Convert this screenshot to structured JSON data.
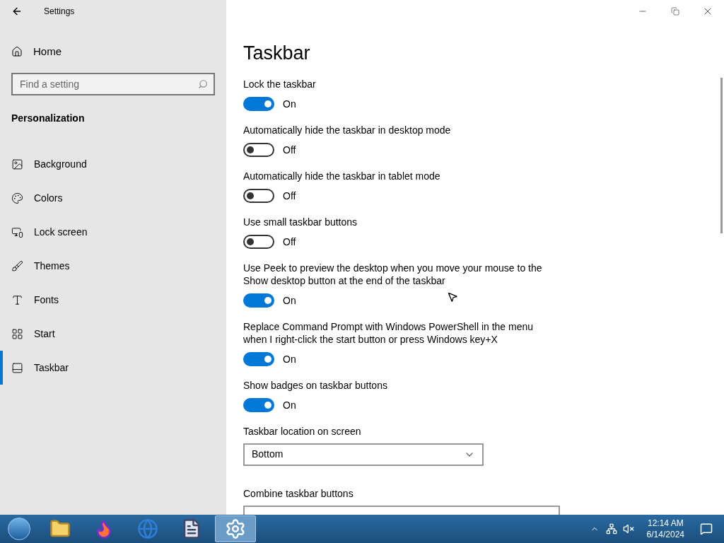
{
  "window": {
    "title": "Settings"
  },
  "sidebar": {
    "home": "Home",
    "search": {
      "placeholder": "Find a setting"
    },
    "section": "Personalization",
    "items": [
      {
        "label": "Background",
        "selected": false
      },
      {
        "label": "Colors",
        "selected": false
      },
      {
        "label": "Lock screen",
        "selected": false
      },
      {
        "label": "Themes",
        "selected": false
      },
      {
        "label": "Fonts",
        "selected": false
      },
      {
        "label": "Start",
        "selected": false
      },
      {
        "label": "Taskbar",
        "selected": true
      }
    ]
  },
  "page": {
    "title": "Taskbar",
    "settings": [
      {
        "kind": "toggle",
        "label": "Lock the taskbar",
        "on": true,
        "state": "On"
      },
      {
        "kind": "toggle",
        "label": "Automatically hide the taskbar in desktop mode",
        "on": false,
        "state": "Off"
      },
      {
        "kind": "toggle",
        "label": "Automatically hide the taskbar in tablet mode",
        "on": false,
        "state": "Off"
      },
      {
        "kind": "toggle",
        "label": "Use small taskbar buttons",
        "on": false,
        "state": "Off"
      },
      {
        "kind": "toggle",
        "label": "Use Peek to preview the desktop when you move your mouse to the Show desktop button at the end of the taskbar",
        "on": true,
        "state": "On"
      },
      {
        "kind": "toggle",
        "label": "Replace Command Prompt with Windows PowerShell in the menu when I right-click the start button or press Windows key+X",
        "on": true,
        "state": "On"
      },
      {
        "kind": "toggle",
        "label": "Show badges on taskbar buttons",
        "on": true,
        "state": "On"
      },
      {
        "kind": "dropdown",
        "label": "Taskbar location on screen",
        "value": "Bottom"
      },
      {
        "kind": "dropdown-cut",
        "label": "Combine taskbar buttons"
      }
    ]
  },
  "taskbar": {
    "apps": [
      {
        "selected": false
      },
      {
        "selected": false
      },
      {
        "selected": false
      },
      {
        "selected": false
      },
      {
        "selected": true
      }
    ],
    "clock": {
      "time": "12:14 AM",
      "date": "6/14/2024"
    }
  }
}
